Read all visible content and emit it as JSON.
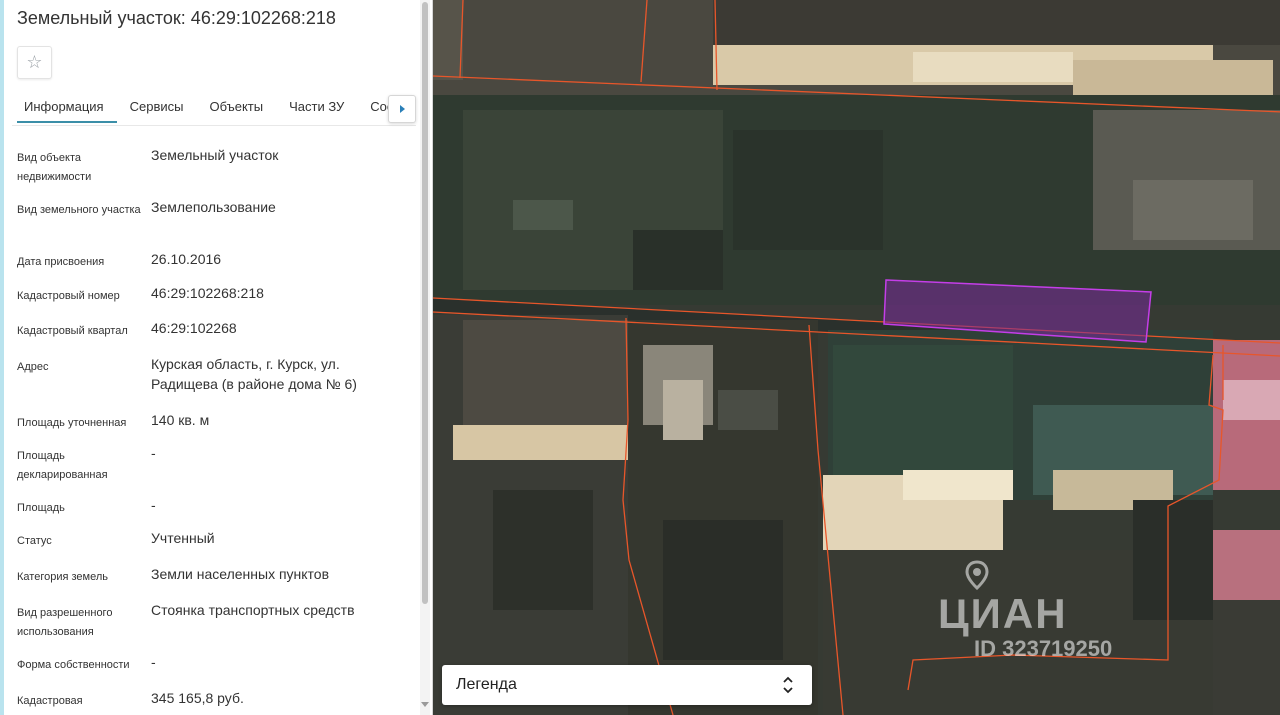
{
  "panel": {
    "title": "Земельный участок: 46:29:102268:218",
    "tabs": [
      {
        "label": "Информация",
        "active": true
      },
      {
        "label": "Сервисы",
        "active": false
      },
      {
        "label": "Объекты",
        "active": false
      },
      {
        "label": "Части ЗУ",
        "active": false
      },
      {
        "label": "Состав",
        "active": false
      }
    ],
    "properties": [
      {
        "label": "Вид объекта недвижимости",
        "value": "Земельный участок"
      },
      {
        "label": "Вид земельного участка",
        "value": "Землепользование"
      },
      {
        "label": "Дата присвоения",
        "value": "26.10.2016"
      },
      {
        "label": "Кадастровый номер",
        "value": "46:29:102268:218"
      },
      {
        "label": "Кадастровый квартал",
        "value": "46:29:102268"
      },
      {
        "label": "Адрес",
        "value": "Курская область, г. Курск, ул. Радищева (в районе дома № 6)"
      },
      {
        "label": "Площадь уточненная",
        "value": "140 кв. м"
      },
      {
        "label": "Площадь декларированная",
        "value": "-"
      },
      {
        "label": "Площадь",
        "value": "-"
      },
      {
        "label": "Статус",
        "value": "Учтенный"
      },
      {
        "label": "Категория земель",
        "value": "Земли населенных пунктов"
      },
      {
        "label": "Вид разрешенного использования",
        "value": "Стоянка транспортных средств"
      },
      {
        "label": "Форма собственности",
        "value": "-"
      },
      {
        "label": "Кадастровая",
        "value": "345 165,8 руб."
      }
    ]
  },
  "icons": {
    "favorite": "star-outline-icon",
    "tabs_next": "caret-right-icon",
    "legend_toggle": "chevron-up-down-icon"
  },
  "map": {
    "legend_label": "Легенда",
    "watermark_brand": "ЦИАН",
    "watermark_id": "ID 323719250",
    "highlight_color": "#a01fd0",
    "boundary_color": "#e8562a"
  }
}
